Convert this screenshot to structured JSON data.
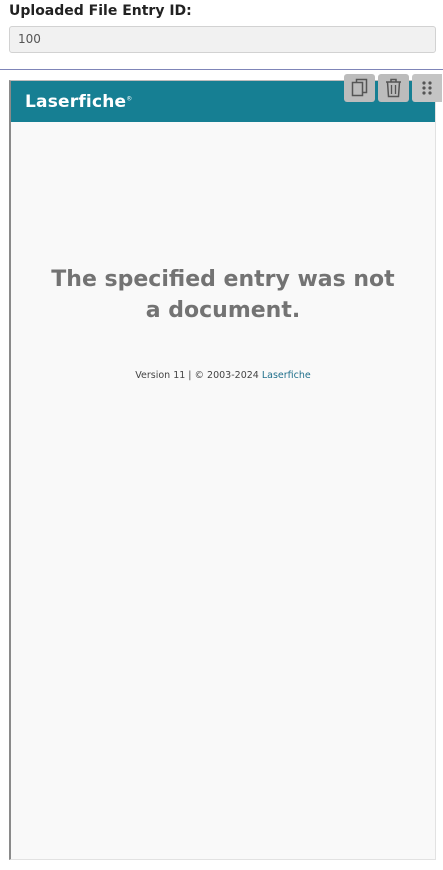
{
  "field": {
    "label": "Uploaded File Entry ID:",
    "value": "100"
  },
  "viewer": {
    "brand": "Laserfiche",
    "brand_mark": "®",
    "message_line1": "The specified entry was not",
    "message_line2": "a document.",
    "version_text": "Version 11 | © 2003-2024 ",
    "version_link": "Laserfiche",
    "banner_color": "#167f93"
  },
  "toolbar": {
    "icons": [
      "copy-icon",
      "trash-icon",
      "drag-handle-icon"
    ]
  }
}
